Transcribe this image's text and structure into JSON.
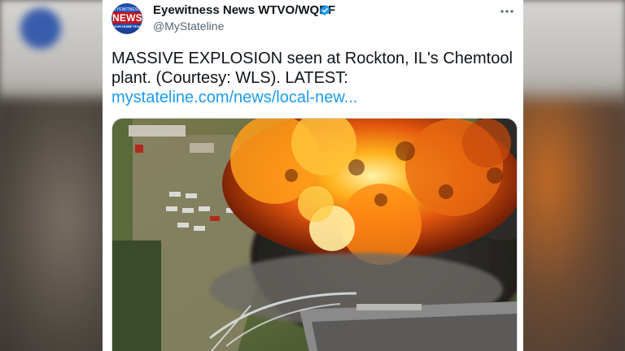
{
  "tweet": {
    "display_name": "Eyewitness News WTVO/WQRF",
    "handle": "@MyStateline",
    "text": "MASSIVE EXPLOSION seen at Rockton, IL's Chemtool plant. (Courtesy: WLS). LATEST:",
    "link_text": "mystateline.com/news/local-new...",
    "verified": true
  },
  "avatar": {
    "logo_word": "NEWS",
    "top_word": "EYEWITNESS",
    "bottom_word": "YOUR HOME TEAM"
  },
  "icons": {
    "verified": "verified-badge-icon",
    "more": "more-options-icon"
  },
  "colors": {
    "link": "#1d9bf0",
    "verified": "#1d9bf0",
    "text": "#0f1419",
    "secondary": "#536471"
  },
  "media": {
    "type": "video-still",
    "subject": "aerial view of explosion at chemical plant"
  }
}
